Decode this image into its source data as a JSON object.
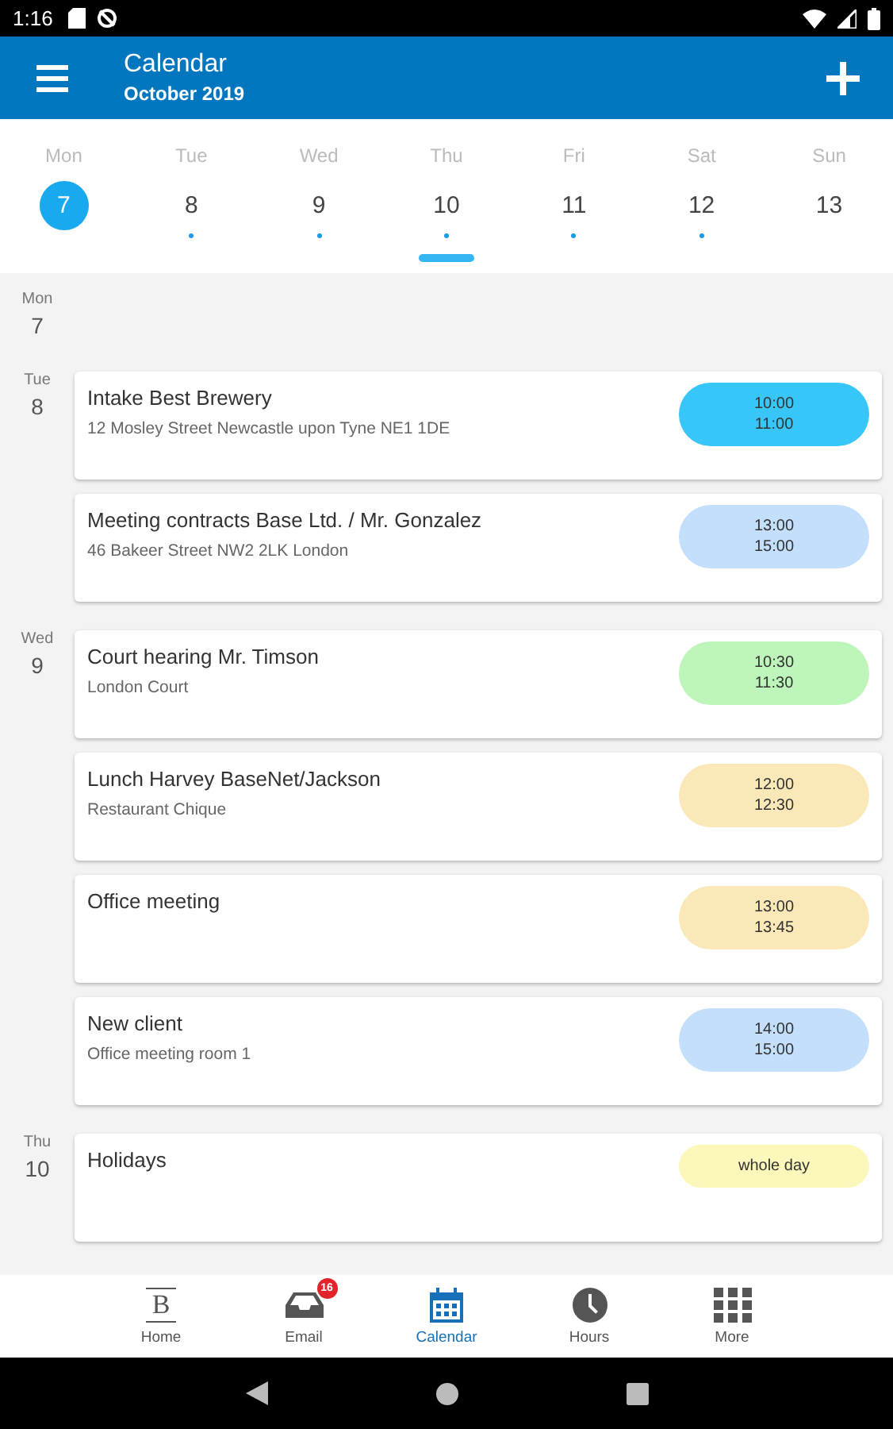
{
  "status_bar": {
    "time": "1:16"
  },
  "header": {
    "title": "Calendar",
    "subtitle": "October 2019"
  },
  "week": [
    {
      "weekday": "Mon",
      "day": "7",
      "selected": true,
      "has_events": false,
      "today": false
    },
    {
      "weekday": "Tue",
      "day": "8",
      "selected": false,
      "has_events": true,
      "today": false
    },
    {
      "weekday": "Wed",
      "day": "9",
      "selected": false,
      "has_events": true,
      "today": false
    },
    {
      "weekday": "Thu",
      "day": "10",
      "selected": false,
      "has_events": true,
      "today": true
    },
    {
      "weekday": "Fri",
      "day": "11",
      "selected": false,
      "has_events": true,
      "today": false
    },
    {
      "weekday": "Sat",
      "day": "12",
      "selected": false,
      "has_events": true,
      "today": false
    },
    {
      "weekday": "Sun",
      "day": "13",
      "selected": false,
      "has_events": false,
      "today": false
    }
  ],
  "agenda": [
    {
      "weekday": "Mon",
      "day": "7"
    },
    {
      "weekday": "Tue",
      "day": "8",
      "events": [
        {
          "title": "Intake Best Brewery",
          "location": "12 Mosley Street Newcastle upon Tyne NE1 1DE",
          "time": [
            "10:00",
            "11:00"
          ],
          "color": "#38c6f8"
        },
        {
          "title": "Meeting contracts Base Ltd. / Mr. Gonzalez",
          "location": "46 Bakeer Street NW2 2LK London",
          "time": [
            "13:00",
            "15:00"
          ],
          "color": "#c3dffb"
        }
      ]
    },
    {
      "weekday": "Wed",
      "day": "9",
      "events": [
        {
          "title": "Court hearing Mr. Timson",
          "location": "London Court",
          "time": [
            "10:30",
            "11:30"
          ],
          "color": "#bdf5bb"
        },
        {
          "title": "Lunch Harvey BaseNet/Jackson",
          "location": "Restaurant Chique",
          "time": [
            "12:00",
            "12:30"
          ],
          "color": "#fbe8b9"
        },
        {
          "title": "Office meeting",
          "time": [
            "13:00",
            "13:45"
          ],
          "color": "#fbe8b9"
        },
        {
          "title": "New client",
          "location": "Office meeting room 1",
          "time": [
            "14:00",
            "15:00"
          ],
          "color": "#c3dffb"
        }
      ]
    },
    {
      "weekday": "Thu",
      "day": "10",
      "events": [
        {
          "title": "Holidays",
          "time": [
            "whole day"
          ],
          "color": "#fcf8bb"
        }
      ]
    }
  ],
  "bottom_nav": [
    {
      "kind": "home",
      "label": "Home",
      "glyph": "B",
      "selected": false
    },
    {
      "kind": "email",
      "label": "Email",
      "badge": "16",
      "selected": false
    },
    {
      "kind": "calendar",
      "label": "Calendar",
      "selected": true
    },
    {
      "kind": "hours",
      "label": "Hours",
      "selected": false
    },
    {
      "kind": "more",
      "label": "More",
      "selected": false
    }
  ]
}
